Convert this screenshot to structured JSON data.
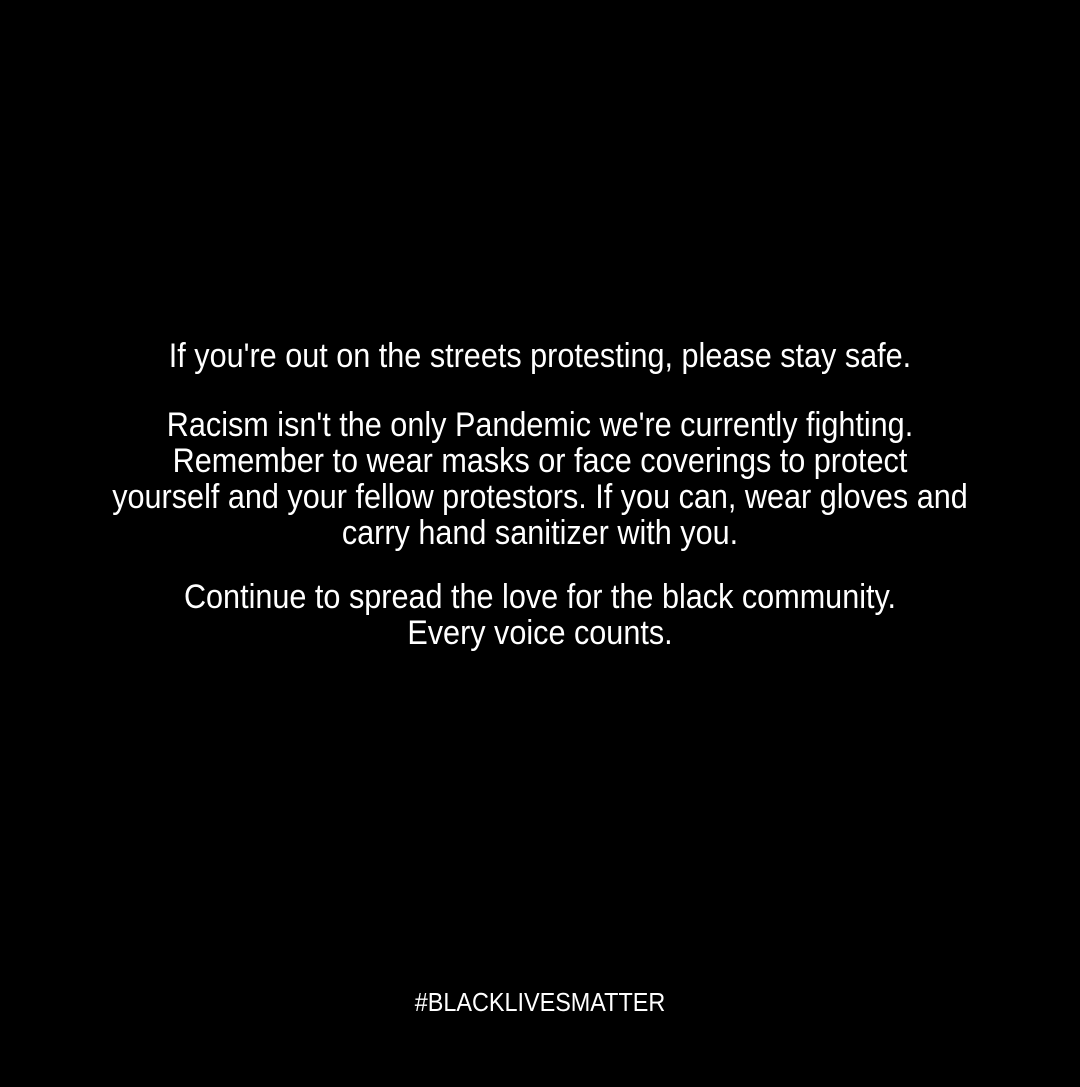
{
  "post": {
    "background_color": "#000000",
    "text_color": "#ffffff",
    "paragraph_1": {
      "line_1": "If you're out on the streets protesting, please stay safe."
    },
    "paragraph_2": {
      "line_1": "Racism isn't the only Pandemic we're currently fighting.",
      "line_2": "Remember to wear  masks or face coverings to protect",
      "line_3": "yourself and your fellow protestors. If you can, wear gloves and",
      "line_4": "carry hand sanitizer with you."
    },
    "paragraph_3": {
      "line_1": "Continue to spread the love for the black community.",
      "line_2": "Every voice counts."
    },
    "hashtag": "#BLACKLIVESMATTER"
  }
}
